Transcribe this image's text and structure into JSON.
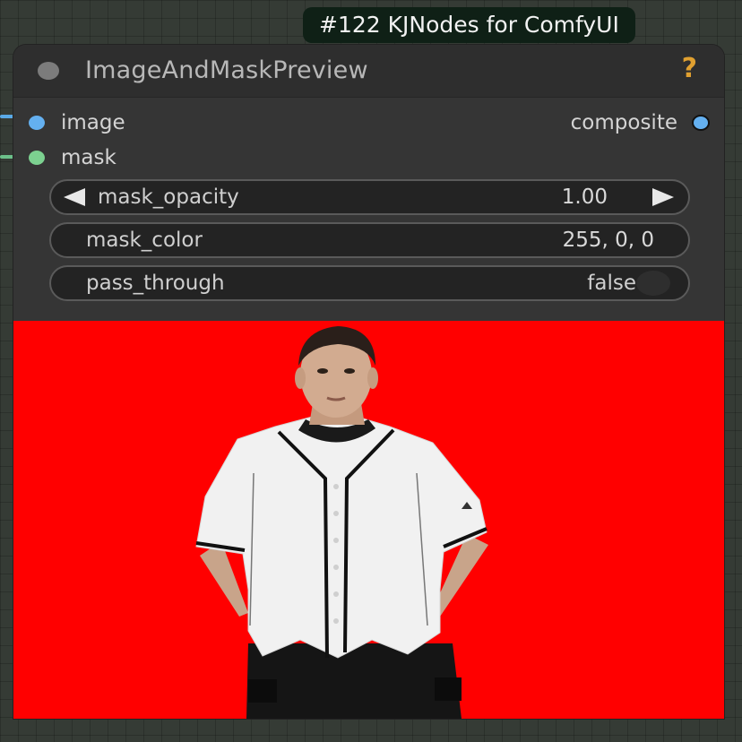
{
  "badge": {
    "text": "#122 KJNodes for ComfyUI"
  },
  "node": {
    "title": "ImageAndMaskPreview",
    "help_icon": "?",
    "inputs": [
      {
        "label": "image",
        "color": "#64b0f0"
      },
      {
        "label": "mask",
        "color": "#7cd190"
      }
    ],
    "outputs": [
      {
        "label": "composite",
        "color": "#64b0f0"
      }
    ],
    "widgets": {
      "mask_opacity": {
        "label": "mask_opacity",
        "value": "1.00"
      },
      "mask_color": {
        "label": "mask_color",
        "value": "255, 0, 0"
      },
      "pass_through": {
        "label": "pass_through",
        "value": "false"
      }
    }
  },
  "preview": {
    "background_color": "#ff0000",
    "subject": "person-in-white-baseball-jersey"
  },
  "colors": {
    "canvas_bg": "#353b35",
    "node_bg": "#353535",
    "header_bg": "#2e2e2e",
    "badge_bg": "#0f2016",
    "help_icon": "#e0a030"
  }
}
